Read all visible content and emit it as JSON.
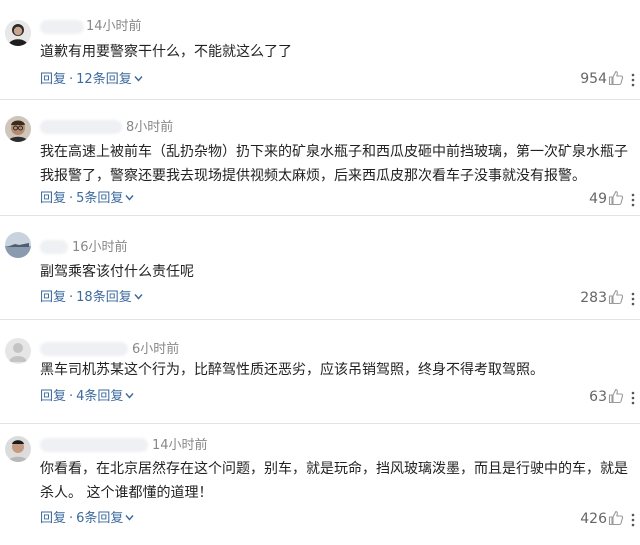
{
  "comments": [
    {
      "time": "14小时前",
      "text": "道歉有用要警察干什么，不能就这么了了",
      "reply_label": "回复",
      "replies_label": "12条回复",
      "likes": "954"
    },
    {
      "time": "8小时前",
      "text": "我在高速上被前车（乱扔杂物）扔下来的矿泉水瓶子和西瓜皮砸中前挡玻璃，第一次矿泉水瓶子我报警了，警察还要我去现场提供视频太麻烦，后来西瓜皮那次看车子没事就没有报警。",
      "reply_label": "回复",
      "replies_label": "5条回复",
      "likes": "49"
    },
    {
      "time": "16小时前",
      "text": "副驾乘客该付什么责任呢",
      "reply_label": "回复",
      "replies_label": "18条回复",
      "likes": "283"
    },
    {
      "time": "6小时前",
      "text": "黑车司机苏某这个行为，比醉驾性质还恶劣，应该吊销驾照，终身不得考取驾照。",
      "reply_label": "回复",
      "replies_label": "4条回复",
      "likes": "63"
    },
    {
      "time": "14小时前",
      "text": "你看看，在北京居然存在这个问题，别车，就是玩命，挡风玻璃泼墨，而且是行驶中的车，就是杀人。 这个谁都懂的道理！",
      "reply_label": "回复",
      "replies_label": "6条回复",
      "likes": "426"
    }
  ],
  "separator": "·",
  "icons": {
    "like": "thumbs-up-icon",
    "more": "vertical-dots-icon",
    "expand": "chevron-down-icon"
  },
  "colors": {
    "link": "#3c6a9c",
    "meta": "#888888",
    "text": "#222222",
    "divider": "#e3e3e3"
  }
}
